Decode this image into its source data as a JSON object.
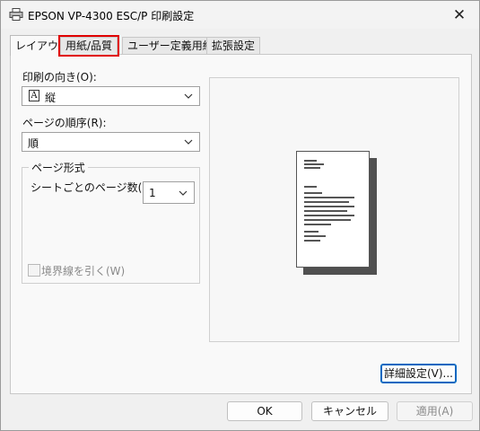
{
  "window": {
    "title": "EPSON VP-4300 ESC/P 印刷設定",
    "close_glyph": "✕"
  },
  "tabs": [
    {
      "label": "レイアウト",
      "active": true
    },
    {
      "label": "用紙/品質",
      "highlighted": true
    },
    {
      "label": "ユーザー定義用紙"
    },
    {
      "label": "拡張設定"
    }
  ],
  "layout": {
    "orientation_label": "印刷の向き(O):",
    "orientation_icon_glyph": "A",
    "orientation_value": "縦",
    "page_order_label": "ページの順序(R):",
    "page_order_value": "順",
    "page_format": {
      "group_title": "ページ形式",
      "pages_per_sheet_label": "シートごとのページ数(S)",
      "pages_per_sheet_value": "1",
      "draw_borders_label": "境界線を引く(W)",
      "draw_borders_checked": false,
      "draw_borders_enabled": false
    },
    "advanced_button": "詳細設定(V)..."
  },
  "footer": {
    "ok": "OK",
    "cancel": "キャンセル",
    "apply": "適用(A)"
  },
  "colors": {
    "highlight": "#e00000",
    "accent": "#0067c0"
  }
}
